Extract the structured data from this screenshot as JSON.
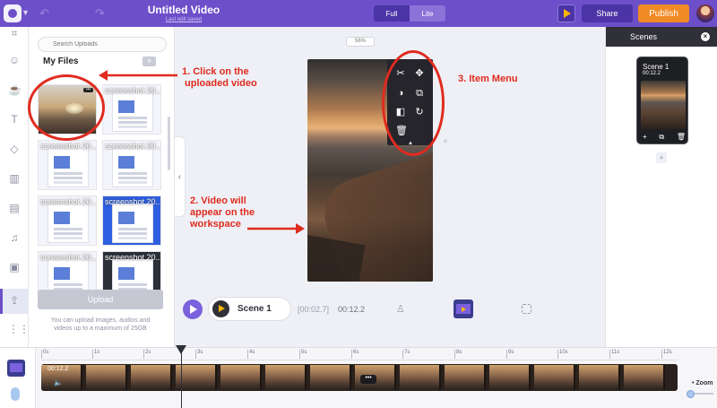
{
  "app": {
    "title": "Untitled Video",
    "saved_text": "Last edit saved",
    "mode_full": "Full",
    "mode_lite": "Lite",
    "share_label": "Share",
    "publish_label": "Publish",
    "brand_color": "#6d4fc9",
    "publish_color": "#f08a24"
  },
  "uploads": {
    "search_placeholder": "Search Uploads",
    "section_title": "My Files",
    "thumbs": [
      {
        "label": "screenshot 20...",
        "kind": "video"
      },
      {
        "label": "screenshot 20...",
        "kind": "doc"
      },
      {
        "label": "screenshot 20...",
        "kind": "doc"
      },
      {
        "label": "screenshot 20...",
        "kind": "doc"
      },
      {
        "label": "screenshot 20...",
        "kind": "doc"
      },
      {
        "label": "screenshot 20...",
        "kind": "blue"
      },
      {
        "label": "screenshot 20...",
        "kind": "doc"
      },
      {
        "label": "screenshot 20...",
        "kind": "dark"
      }
    ],
    "upload_button": "Upload",
    "note": "You can upload images, audios and videos up to a maximum of 25GB"
  },
  "workspace": {
    "zoom": "56%"
  },
  "annotations": {
    "step1": "1. Click on the\n uploaded video",
    "step2": "2. Video will\nappear on the\nworkspace",
    "step3": "3. Item Menu"
  },
  "scenes": {
    "title": "Scenes",
    "items": [
      {
        "name": "Scene 1",
        "duration": "00:12.2"
      }
    ]
  },
  "player": {
    "scene_label": "Scene 1",
    "time_current": "[00:02.7]",
    "time_total": "00:12.2"
  },
  "timeline": {
    "ticks": [
      "0s",
      "1s",
      "2s",
      "3s",
      "4s",
      "5s",
      "6s",
      "7s",
      "8s",
      "9s",
      "10s",
      "11s",
      "12s"
    ],
    "track_label": "00:12.2",
    "zoom_label": "Zoom"
  }
}
